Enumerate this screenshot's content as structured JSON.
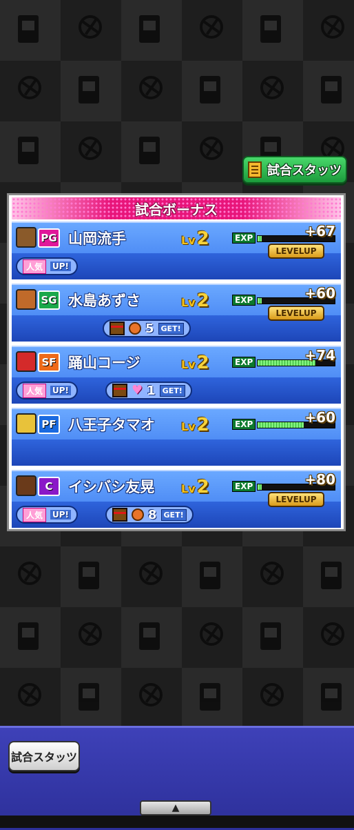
{
  "top_button": {
    "label": "試合スタッツ",
    "icon": "scoresheet-icon"
  },
  "panel": {
    "title": "試合ボーナス"
  },
  "players": [
    {
      "name": "山岡流手",
      "position": "PG",
      "position_color": "#e0189a",
      "face_color": "#8a5a2a",
      "lv_label": "Lv",
      "level": "2",
      "exp_label": "EXP",
      "exp_gain": "+67",
      "exp_fill": 0.05,
      "level_up": true,
      "level_up_label": "LEVELUP",
      "bonuses": [
        {
          "type": "popularity",
          "label": "人気",
          "up": "UP!"
        }
      ]
    },
    {
      "name": "水島あずさ",
      "position": "SG",
      "position_color": "#1aa84a",
      "face_color": "#c06a2a",
      "lv_label": "Lv",
      "level": "2",
      "exp_label": "EXP",
      "exp_gain": "+60",
      "exp_fill": 0.05,
      "level_up": true,
      "level_up_label": "LEVELUP",
      "bonuses": [
        {
          "type": "item",
          "icon": "basketball-icon",
          "count": "5",
          "get": "GET!"
        }
      ]
    },
    {
      "name": "踊山コージ",
      "position": "SF",
      "position_color": "#ee6a18",
      "face_color": "#d42a2a",
      "lv_label": "Lv",
      "level": "2",
      "exp_label": "EXP",
      "exp_gain": "+74",
      "exp_fill": 0.75,
      "level_up": false,
      "bonuses": [
        {
          "type": "popularity",
          "label": "人気",
          "up": "UP!"
        },
        {
          "type": "item",
          "icon": "heart-icon",
          "count": "1",
          "get": "GET!"
        }
      ]
    },
    {
      "name": "八王子タマオ",
      "position": "PF",
      "position_color": "#1a6ae0",
      "face_color": "#e8c23a",
      "lv_label": "Lv",
      "level": "2",
      "exp_label": "EXP",
      "exp_gain": "+60",
      "exp_fill": 0.6,
      "level_up": false,
      "bonuses": []
    },
    {
      "name": "イシバシ友晃",
      "position": "C",
      "position_color": "#8a18c8",
      "face_color": "#6a3a1a",
      "lv_label": "Lv",
      "level": "2",
      "exp_label": "EXP",
      "exp_gain": "+80",
      "exp_fill": 0.05,
      "level_up": true,
      "level_up_label": "LEVELUP",
      "bonuses": [
        {
          "type": "popularity",
          "label": "人気",
          "up": "UP!"
        },
        {
          "type": "item",
          "icon": "basketball-icon",
          "count": "8",
          "get": "GET!"
        }
      ]
    }
  ],
  "bottom_button": {
    "label": "試合スタッツ"
  },
  "collapse_tab": {
    "icon": "up-arrow-icon",
    "glyph": "▲"
  }
}
